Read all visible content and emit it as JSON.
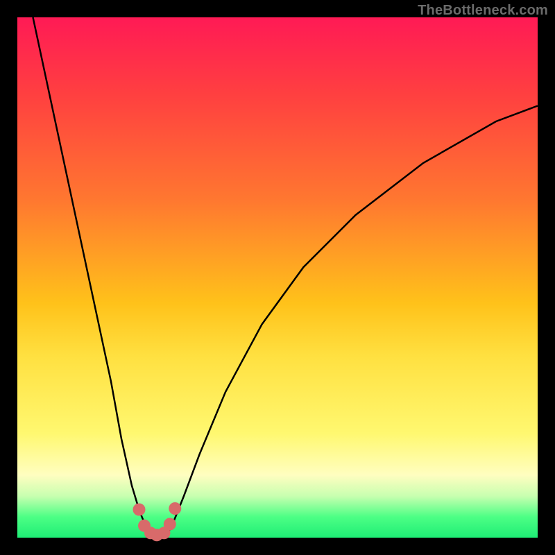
{
  "watermark": "TheBottleneck.com",
  "colors": {
    "background": "#000000",
    "gradient_top": "#ff1a55",
    "gradient_bottom": "#1eed75",
    "curve": "#000000",
    "beads": "#d86a6a"
  },
  "chart_data": {
    "type": "line",
    "title": "",
    "xlabel": "",
    "ylabel": "",
    "xlim": [
      0,
      100
    ],
    "ylim": [
      0,
      100
    ],
    "series": [
      {
        "name": "left-branch",
        "x": [
          3,
          6,
          9,
          12,
          15,
          18,
          20,
          22,
          23.5,
          25,
          26,
          27
        ],
        "y": [
          100,
          86,
          72,
          58,
          44,
          30,
          19,
          10,
          5,
          1.5,
          0.4,
          0.1
        ]
      },
      {
        "name": "right-branch",
        "x": [
          27,
          28,
          29,
          30,
          32,
          35,
          40,
          47,
          55,
          65,
          78,
          92,
          100
        ],
        "y": [
          0.1,
          0.3,
          1,
          3,
          8,
          16,
          28,
          41,
          52,
          62,
          72,
          80,
          83
        ]
      }
    ],
    "markers": {
      "name": "beads",
      "x": [
        23.4,
        24.4,
        25.6,
        26.8,
        28.2,
        29.3,
        30.3
      ],
      "y": [
        5.4,
        2.3,
        0.9,
        0.5,
        0.9,
        2.6,
        5.6
      ]
    }
  }
}
